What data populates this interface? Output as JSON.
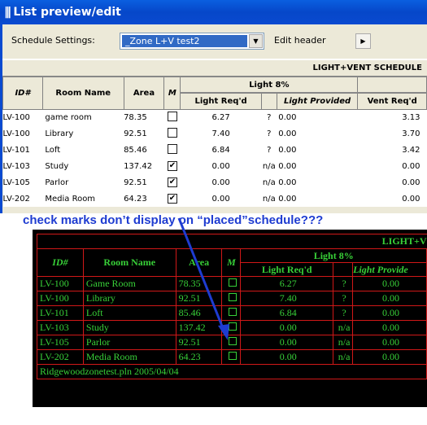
{
  "window": {
    "title": "List preview/edit",
    "icon": "list-icon"
  },
  "settings": {
    "label": "Schedule Settings:",
    "value": "_Zone L+V test2",
    "edit_header": "Edit header"
  },
  "schedule_title": "LIGHT+VENT SCHEDULE",
  "headers": {
    "id": "ID#",
    "room": "Room Name",
    "area": "Area",
    "m": "M",
    "light_group": "Light 8%",
    "light_req": "Light Req'd",
    "light_prov": "Light Provided",
    "vent_req": "Vent Req'd"
  },
  "rows": [
    {
      "id": "LV-100",
      "room": "game room",
      "area": "78.35",
      "m": false,
      "lreq": "6.27",
      "flag": "?",
      "lprov": "0.00",
      "vreq": "3.13"
    },
    {
      "id": "LV-100",
      "room": "Library",
      "area": "92.51",
      "m": false,
      "lreq": "7.40",
      "flag": "?",
      "lprov": "0.00",
      "vreq": "3.70"
    },
    {
      "id": "LV-101",
      "room": "Loft",
      "area": "85.46",
      "m": false,
      "lreq": "6.84",
      "flag": "?",
      "lprov": "0.00",
      "vreq": "3.42"
    },
    {
      "id": "LV-103",
      "room": "Study",
      "area": "137.42",
      "m": true,
      "lreq": "0.00",
      "flag": "n/a",
      "lprov": "0.00",
      "vreq": "0.00"
    },
    {
      "id": "LV-105",
      "room": "Parlor",
      "area": "92.51",
      "m": true,
      "lreq": "0.00",
      "flag": "n/a",
      "lprov": "0.00",
      "vreq": "0.00"
    },
    {
      "id": "LV-202",
      "room": "Media Room",
      "area": "64.23",
      "m": true,
      "lreq": "0.00",
      "flag": "n/a",
      "lprov": "0.00",
      "vreq": "0.00"
    }
  ],
  "annotation": "check marks don’t display on “placed”schedule???",
  "placed": {
    "title": "LIGHT+V",
    "headers": {
      "id": "ID#",
      "room": "Room Name",
      "area": "Area",
      "m": "M",
      "light_group": "Light 8%",
      "light_req": "Light Req'd",
      "light_prov": "Light Provide"
    },
    "rows": [
      {
        "id": "LV-100",
        "room": "Game Room",
        "area": "78.35",
        "lreq": "6.27",
        "flag": "?",
        "lprov": "0.00"
      },
      {
        "id": "LV-100",
        "room": "Library",
        "area": "92.51",
        "lreq": "7.40",
        "flag": "?",
        "lprov": "0.00"
      },
      {
        "id": "LV-101",
        "room": "Loft",
        "area": "85.46",
        "lreq": "6.84",
        "flag": "?",
        "lprov": "0.00"
      },
      {
        "id": "LV-103",
        "room": "Study",
        "area": "137.42",
        "lreq": "0.00",
        "flag": "n/a",
        "lprov": "0.00"
      },
      {
        "id": "LV-105",
        "room": "Parlor",
        "area": "92.51",
        "lreq": "0.00",
        "flag": "n/a",
        "lprov": "0.00"
      },
      {
        "id": "LV-202",
        "room": "Media Room",
        "area": "64.23",
        "lreq": "0.00",
        "flag": "n/a",
        "lprov": "0.00"
      }
    ],
    "footer": "Ridgewoodzonetest.pln 2005/04/04"
  },
  "colors": {
    "placed_text": "#38d038",
    "placed_grid": "#d01818",
    "annotation": "#1e3cd1",
    "selection": "#316ac5"
  }
}
